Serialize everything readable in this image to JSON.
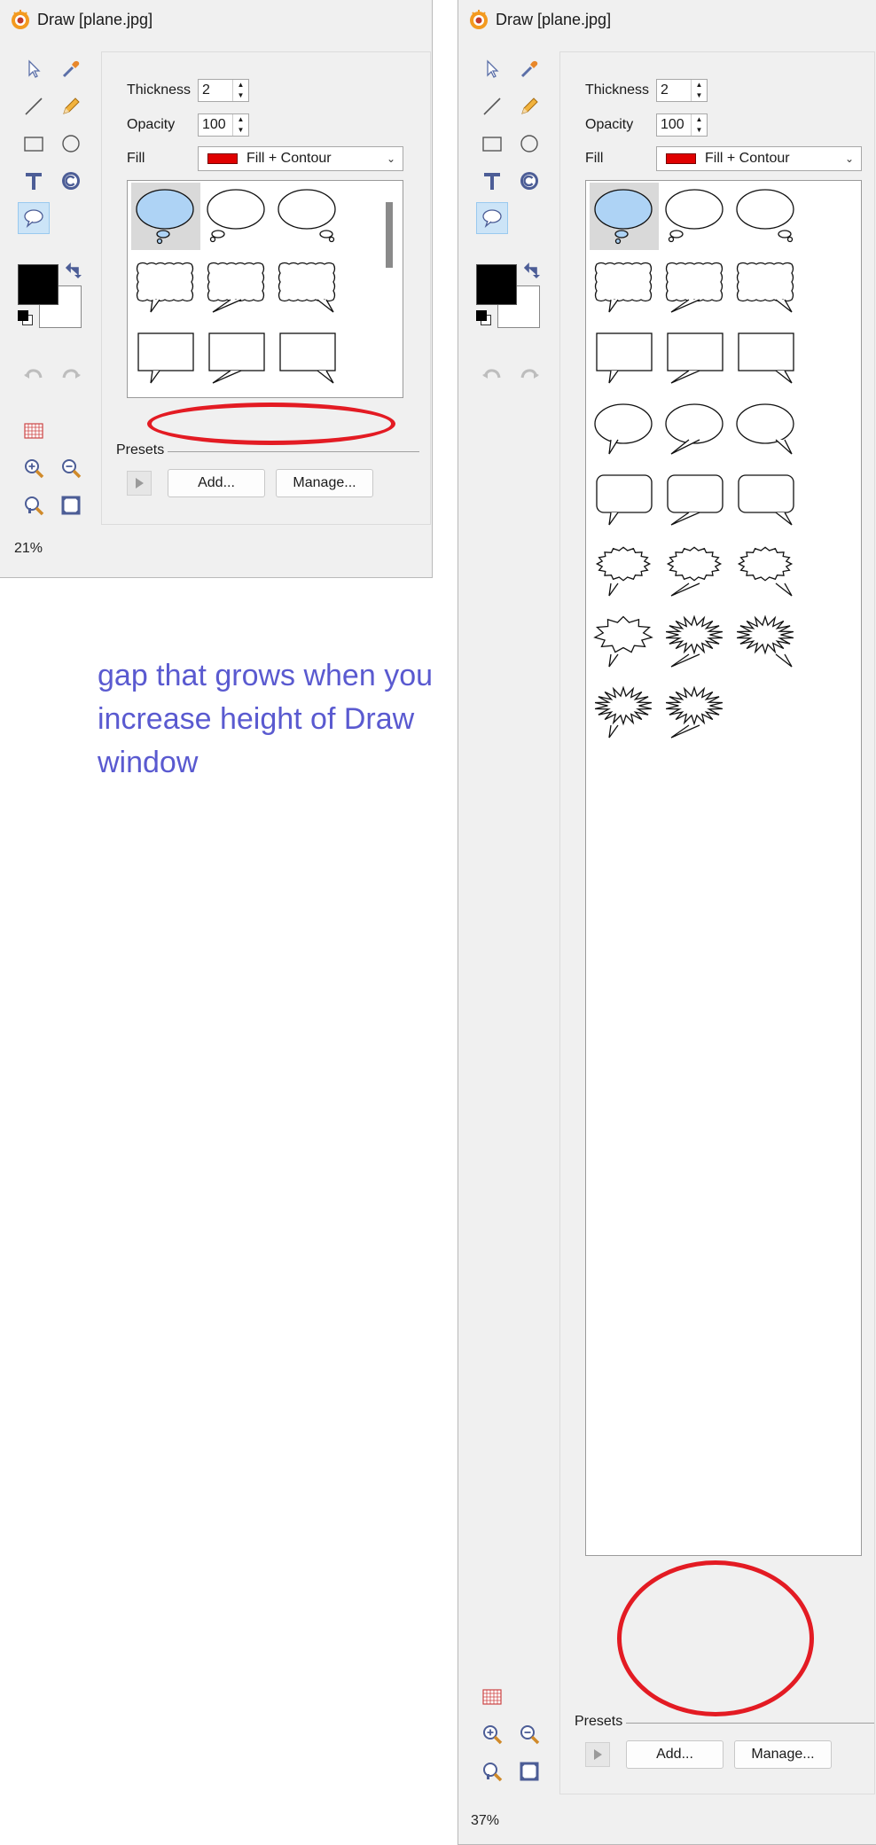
{
  "window_title": "Draw [plane.jpg]",
  "labels": {
    "thickness": "Thickness",
    "opacity": "Opacity",
    "fill": "Fill",
    "presets": "Presets"
  },
  "values": {
    "thickness": "2",
    "opacity": "100",
    "fill_mode": "Fill + Contour"
  },
  "buttons": {
    "add": "Add...",
    "manage": "Manage..."
  },
  "left_window": {
    "zoom": "21%"
  },
  "right_window": {
    "zoom": "37%"
  },
  "annotation": "gap that grows when you increase height of Draw window",
  "colors": {
    "fill_swatch": "#e00000",
    "annotation_oval": "#e31b23",
    "annotation_text": "#5a5ad0",
    "selected_tool": "#cce4f7",
    "bubble_fill_selected": "#aed3f5"
  },
  "icons": {
    "tools": [
      "select-arrow-icon",
      "eyedropper-icon",
      "line-icon",
      "pencil-icon",
      "rectangle-icon",
      "ellipse-icon",
      "text-icon",
      "copyright-icon",
      "speech-bubble-icon"
    ],
    "history": [
      "undo-icon",
      "redo-icon"
    ],
    "view": [
      "grid-icon",
      "zoom-in-icon",
      "zoom-out-icon",
      "zoom-actual-icon",
      "fit-window-icon"
    ]
  },
  "bubble_shapes": [
    "cloud",
    "cloud",
    "cloud",
    "wavy",
    "wavy",
    "wavy",
    "square",
    "square",
    "square",
    "oval",
    "oval",
    "oval",
    "rounded",
    "rounded",
    "rounded",
    "jagged",
    "jagged",
    "jagged",
    "burst",
    "spiky",
    "spiky",
    "spiky",
    "spiky"
  ]
}
